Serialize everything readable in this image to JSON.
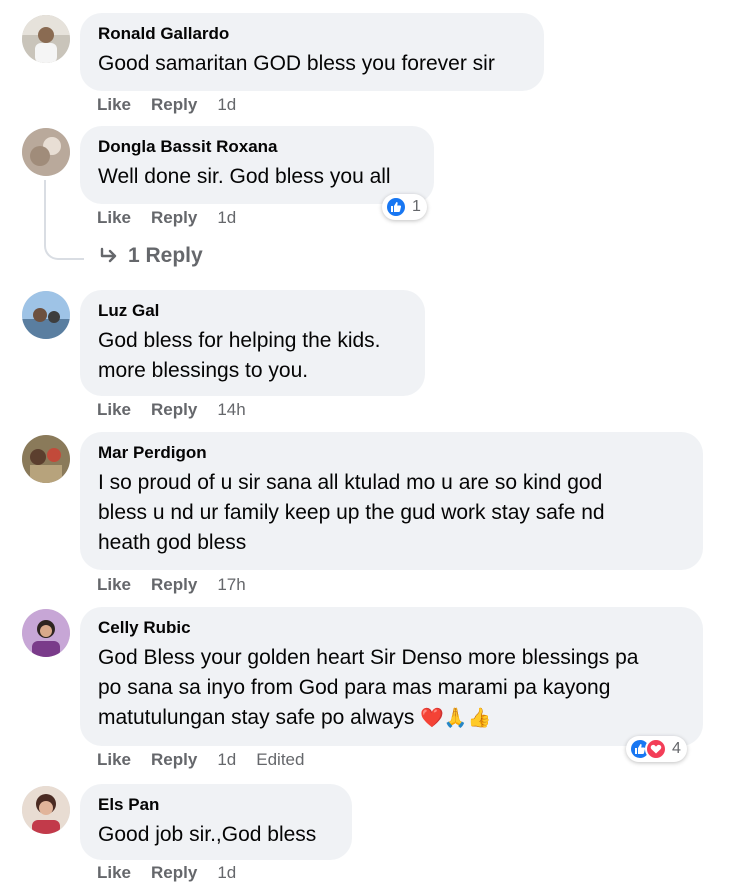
{
  "comments": [
    {
      "author": "Ronald Gallardo",
      "text": "Good samaritan GOD bless you forever sir",
      "like": "Like",
      "reply": "Reply",
      "time": "1d"
    },
    {
      "author": "Dongla Bassit Roxana",
      "text": "Well done sir. God bless you all",
      "like": "Like",
      "reply": "Reply",
      "time": "1d",
      "reaction_count": "1",
      "replies_link": "1 Reply"
    },
    {
      "author": "Luz Gal",
      "text_line1": "God bless for helping the kids.",
      "text_line2": "more blessings to you.",
      "like": "Like",
      "reply": "Reply",
      "time": "14h"
    },
    {
      "author": "Mar Perdigon",
      "text_line1": "I so proud of u sir sana all ktulad mo u are so kind god",
      "text_line2": "bless u nd ur family keep up the gud work stay safe nd",
      "text_line3": "heath god bless",
      "like": "Like",
      "reply": "Reply",
      "time": "17h"
    },
    {
      "author": "Celly Rubic",
      "text_line1": "God Bless your golden heart Sir Denso more blessings pa",
      "text_line2": "po sana sa inyo from God para mas marami pa kayong",
      "text_line3": "matutulungan stay safe po always",
      "emojis": "❤️🙏👍",
      "like": "Like",
      "reply": "Reply",
      "time": "1d",
      "edited": "Edited",
      "reaction_count": "4"
    },
    {
      "author": "Els Pan",
      "text": "Good job sir.,God bless",
      "like": "Like",
      "reply": "Reply",
      "time": "1d"
    }
  ],
  "colors": {
    "bubble": "#f0f2f5",
    "meta_text": "#65676b",
    "like_blue": "#1877f2",
    "love_red": "#f33e58"
  }
}
